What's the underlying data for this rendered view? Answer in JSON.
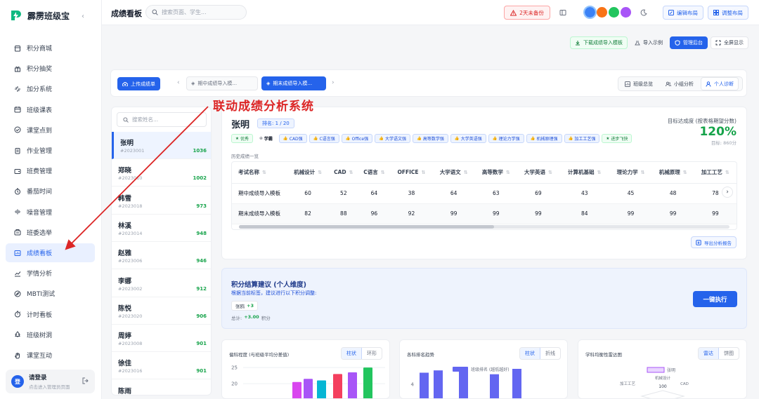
{
  "app": {
    "name": "霹雳班级宝",
    "page_title": "成绩看板",
    "search_placeholder": "搜索页面、学生..."
  },
  "sidebar": {
    "items": [
      {
        "label": "积分商城",
        "icon": "store-icon"
      },
      {
        "label": "积分抽奖",
        "icon": "gift-icon"
      },
      {
        "label": "加分系统",
        "icon": "sparkle-icon"
      },
      {
        "label": "班级课表",
        "icon": "calendar-icon"
      },
      {
        "label": "课堂点到",
        "icon": "check-circle-icon"
      },
      {
        "label": "作业管理",
        "icon": "clipboard-icon"
      },
      {
        "label": "班费管理",
        "icon": "wallet-icon"
      },
      {
        "label": "番茄时间",
        "icon": "timer-icon"
      },
      {
        "label": "噪音管理",
        "icon": "sound-wave-icon"
      },
      {
        "label": "班委选举",
        "icon": "ballot-icon"
      },
      {
        "label": "成绩看板",
        "icon": "board-icon",
        "active": true
      },
      {
        "label": "学情分析",
        "icon": "trend-icon"
      },
      {
        "label": "MBTI测试",
        "icon": "compass-icon"
      },
      {
        "label": "计时看板",
        "icon": "stopwatch-icon"
      },
      {
        "label": "班级树洞",
        "icon": "tree-icon"
      },
      {
        "label": "课堂互动",
        "icon": "hand-icon"
      }
    ],
    "login": {
      "avatar": "登",
      "title": "请登录",
      "subtitle": "点击进入管理员页面"
    }
  },
  "topbar": {
    "backup": "2天未备份",
    "edit_layout": "编辑布局",
    "adjust_layout": "调整布局",
    "theme_colors": [
      "#3b82f6",
      "#f97316",
      "#22c55e",
      "#a855f7"
    ]
  },
  "actions": {
    "download_template": "下载成绩导入模板",
    "import_example": "导入示例",
    "admin": "管理后台",
    "fullscreen": "全屏显示"
  },
  "toolbar": {
    "upload": "上传成绩单",
    "exam_tabs": [
      {
        "label": "期中成绩导入模..."
      },
      {
        "label": "期末成绩导入模...",
        "active": true
      }
    ],
    "views": [
      {
        "label": "班级总览"
      },
      {
        "label": "小组分析"
      },
      {
        "label": "个人诊断",
        "active": true
      }
    ]
  },
  "student_list": {
    "search_placeholder": "搜索姓名...",
    "students": [
      {
        "name": "张明",
        "id": "#2023001",
        "score": "1036",
        "active": true
      },
      {
        "name": "郑晓",
        "id": "#2023010",
        "score": "1002"
      },
      {
        "name": "韩雪",
        "id": "#2023018",
        "score": "973"
      },
      {
        "name": "林溪",
        "id": "#2023014",
        "score": "948"
      },
      {
        "name": "赵雅",
        "id": "#2023006",
        "score": "946"
      },
      {
        "name": "李娜",
        "id": "#2023002",
        "score": "912"
      },
      {
        "name": "陈悦",
        "id": "#2023020",
        "score": "906"
      },
      {
        "name": "周婷",
        "id": "#2023008",
        "score": "901"
      },
      {
        "name": "徐佳",
        "id": "#2023016",
        "score": "901"
      },
      {
        "name": "陈雨",
        "id": "",
        "score": ""
      }
    ]
  },
  "profile": {
    "name": "张明",
    "rank": "排名: 1 / 20",
    "target_label": "目标达成度 (按表格期望分数)",
    "target_percent": "120%",
    "target_sub": "目标: 860分",
    "tags": [
      {
        "label": "优秀",
        "style": "green"
      },
      {
        "label": "学霸",
        "style": "plain"
      },
      {
        "label": "CAD强",
        "style": "blue"
      },
      {
        "label": "C语言强",
        "style": "blue"
      },
      {
        "label": "Office强",
        "style": "blue"
      },
      {
        "label": "大学语文强",
        "style": "blue"
      },
      {
        "label": "高等数学强",
        "style": "blue"
      },
      {
        "label": "大学英语强",
        "style": "blue"
      },
      {
        "label": "理论力学强",
        "style": "blue"
      },
      {
        "label": "机械原理强",
        "style": "blue"
      },
      {
        "label": "加工工艺强",
        "style": "blue"
      },
      {
        "label": "进步飞快",
        "style": "green"
      }
    ],
    "history_label": "历史成绩一览",
    "table": {
      "headers": [
        "考试名称",
        "机械设计",
        "CAD",
        "C语言",
        "OFFICE",
        "大学语文",
        "高等数学",
        "大学英语",
        "计算机基础",
        "理论力学",
        "机械原理",
        "加工工艺"
      ],
      "rows": [
        [
          "期中成绩导入模板",
          "60",
          "52",
          "64",
          "38",
          "64",
          "63",
          "69",
          "43",
          "45",
          "48",
          "78"
        ],
        [
          "期末成绩导入模板",
          "82",
          "88",
          "96",
          "92",
          "99",
          "99",
          "99",
          "84",
          "99",
          "99",
          "99"
        ]
      ]
    },
    "export": "导出分析报告"
  },
  "settlement": {
    "title": "积分结算建议 (个人维度)",
    "subtitle": "根据当前标签，建议进行以下积分调整:",
    "chip_name": "张鸥",
    "chip_value": "+3",
    "total_label": "总计:",
    "total_value": "+3.00",
    "total_unit": "积分",
    "execute": "一键执行"
  },
  "chart_data": [
    {
      "type": "bar",
      "title": "偏科程度 (与班级平均分差值)",
      "toggle": [
        "柱状",
        "环形"
      ],
      "y_ticks": [
        "25",
        "20"
      ],
      "values": [
        20.5,
        21.5,
        21,
        23,
        23.5,
        25
      ],
      "colors": [
        "#d946ef",
        "#a855f7",
        "#06b6d4",
        "#f43f5e",
        "#a855f7",
        "#22c55e"
      ],
      "ylim": [
        15,
        27
      ]
    },
    {
      "type": "bar",
      "title": "各科排名趋势",
      "toggle": [
        "柱状",
        "折线"
      ],
      "legend": "班级排名 (越低越好)",
      "y_ticks": [
        "4"
      ],
      "values": [
        5.5,
        5.8,
        6.2,
        5.3,
        6.0
      ],
      "ylim": [
        2,
        7
      ]
    },
    {
      "type": "radar",
      "title": "学科均衡性雷达图",
      "toggle": [
        "雷达",
        "饼图"
      ],
      "legend": "张明",
      "axis_labels": [
        "机械设计",
        "CAD",
        "加工工艺"
      ],
      "tick": "100"
    }
  ]
}
